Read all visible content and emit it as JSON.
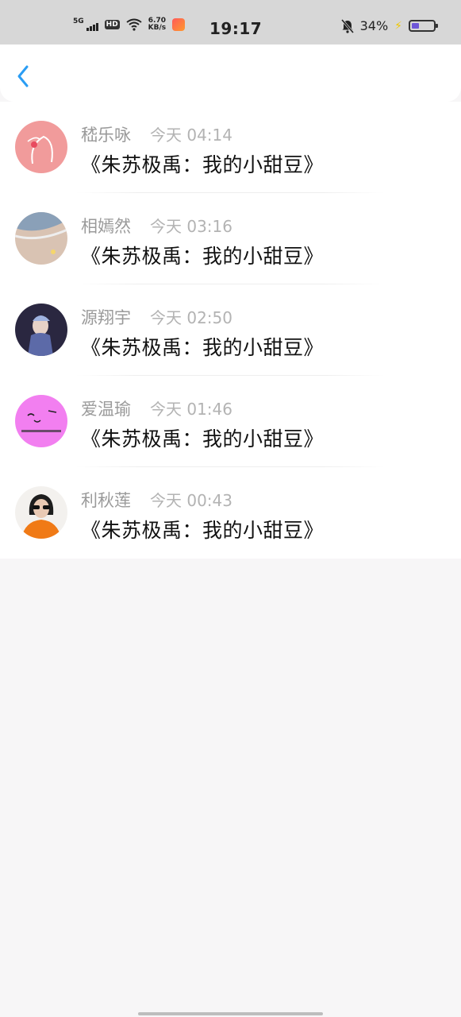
{
  "status_bar": {
    "network": "5G",
    "hd": "HD",
    "speed_top": "6.70",
    "speed_bottom": "KB/s",
    "time": "19:17",
    "battery_text": "34%",
    "battery_level": 0.34
  },
  "colors": {
    "back_arrow": "#2a9df4",
    "status_bar_bg": "#d7d7d7",
    "page_bg": "#f7f6f7"
  },
  "header": {
    "back_icon": "chevron-left-icon"
  },
  "messages": [
    {
      "name": "嵇乐咏",
      "time": "今天 04:14",
      "text": "《朱苏极禹：我的小甜豆》"
    },
    {
      "name": "相嫣然",
      "time": "今天 03:16",
      "text": "《朱苏极禹：我的小甜豆》"
    },
    {
      "name": "源翔宇",
      "time": "今天 02:50",
      "text": "《朱苏极禹：我的小甜豆》"
    },
    {
      "name": "爱温瑜",
      "time": "今天 01:46",
      "text": "《朱苏极禹：我的小甜豆》"
    },
    {
      "name": "利秋莲",
      "time": "今天 00:43",
      "text": "《朱苏极禹：我的小甜豆》"
    }
  ]
}
